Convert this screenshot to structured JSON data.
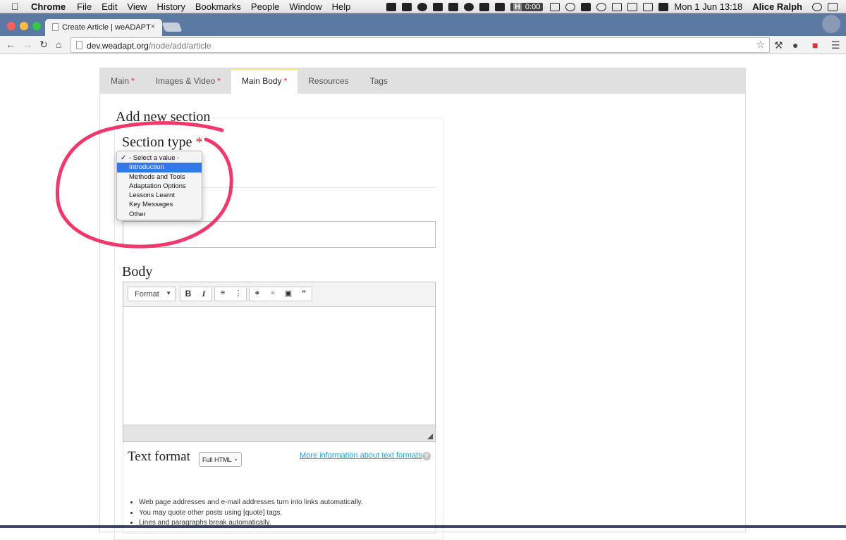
{
  "menubar": {
    "apple": "",
    "app_name": "Chrome",
    "menus": [
      "File",
      "Edit",
      "View",
      "History",
      "Bookmarks",
      "People",
      "Window",
      "Help"
    ],
    "timer_label": "H",
    "timer_value": "0:00",
    "date_time": "Mon 1 Jun  13:18",
    "user": "Alice Ralph"
  },
  "browser": {
    "tab_title": "Create Article | weADAPT",
    "tab_close": "×",
    "url_host": "dev.weadapt.org",
    "url_path": "/node/add/article"
  },
  "form_tabs": [
    {
      "label": "Main",
      "required": "*"
    },
    {
      "label": "Images & Video",
      "required": "*"
    },
    {
      "label": "Main Body",
      "required": "*"
    },
    {
      "label": "Resources",
      "required": ""
    },
    {
      "label": "Tags",
      "required": ""
    }
  ],
  "section": {
    "legend": "Add new section",
    "type_label": "Section type",
    "required_mark": "*"
  },
  "dropdown": {
    "options": [
      "- Select a value -",
      "Introduction",
      "Methods and Tools",
      "Adaptation Options",
      "Lessons Learnt",
      "Key Messages",
      "Other"
    ],
    "checked_index": 0,
    "highlighted_index": 1
  },
  "body": {
    "label": "Body",
    "format_button": "Format"
  },
  "text_format": {
    "label": "Text format",
    "selected": "Full HTML",
    "more_info_link": "More information about text formats",
    "help": "?",
    "tips": [
      "Web page addresses and e-mail addresses turn into links automatically.",
      "You may quote other posts using [quote] tags.",
      "Lines and paragraphs break automatically."
    ]
  },
  "colors": {
    "annotation": "#f0386b",
    "active_tab_accent": "#f6ec7e",
    "link": "#2a9fd6",
    "highlight": "#3477e8"
  }
}
